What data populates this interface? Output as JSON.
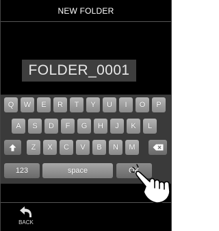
{
  "header": {
    "title": "NEW FOLDER"
  },
  "name_field": {
    "value": "FOLDER_0001"
  },
  "keyboard": {
    "row1": [
      "Q",
      "W",
      "E",
      "R",
      "T",
      "Y",
      "U",
      "I",
      "O",
      "P"
    ],
    "row2": [
      "A",
      "S",
      "D",
      "F",
      "G",
      "H",
      "J",
      "K",
      "L"
    ],
    "row3": [
      "Z",
      "X",
      "C",
      "V",
      "B",
      "N",
      "M"
    ],
    "numbers_label": "123",
    "space_label": "space",
    "ok_label": "OK"
  },
  "footer": {
    "back_label": "BACK",
    "back_icon": "back-arrow-icon"
  },
  "overlay": {
    "icon": "pointing-hand-icon"
  }
}
